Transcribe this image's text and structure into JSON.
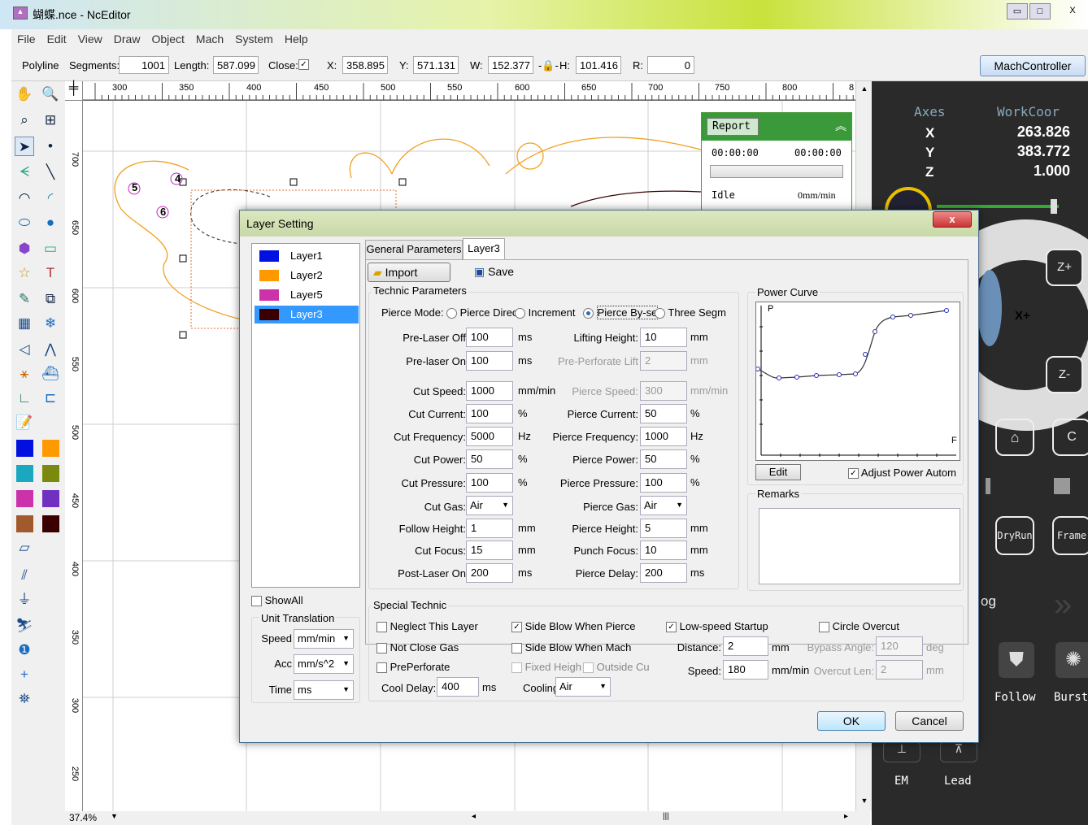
{
  "window": {
    "title": "蝴蝶.nce - NcEditor",
    "min": "▭",
    "max": "□",
    "close": "X"
  },
  "menu": [
    "File",
    "Edit",
    "View",
    "Draw",
    "Object",
    "Mach",
    "System",
    "Help"
  ],
  "props": {
    "type": "Polyline",
    "segments_label": "Segments:",
    "segments": "1001",
    "length_label": "Length:",
    "length": "587.099",
    "close_label": "Close:",
    "close_checked": "✓",
    "x_label": "X:",
    "x": "358.895",
    "y_label": "Y:",
    "y": "571.131",
    "w_label": "W:",
    "w": "152.377",
    "h_label": "H:",
    "h": "101.416",
    "r_label": "R:",
    "r": "0"
  },
  "mach_button": "MachController",
  "ruler_h": [
    "300",
    "350",
    "400",
    "450",
    "500",
    "550",
    "600",
    "650",
    "700",
    "750",
    "800",
    "8"
  ],
  "ruler_v": [
    "700",
    "650",
    "600",
    "550",
    "500",
    "450",
    "400",
    "350",
    "300",
    "250"
  ],
  "canvas_labels": [
    "5",
    "4",
    "6"
  ],
  "zoom": "37.4%",
  "right": {
    "axes": "Axes",
    "workcoor": "WorkCoor",
    "x": "X",
    "y": "Y",
    "z": "Z",
    "xv": "263.826",
    "yv": "383.772",
    "zv": "1.000",
    "zplus": "Z+",
    "zminus": "Z-",
    "xplus": "X+",
    "c": "C",
    "dryrun": "DryRun",
    "frame": "Frame",
    "og": "og",
    "follow": "Follow",
    "burst": "Burst",
    "em": "EM",
    "lead": "Lead"
  },
  "report": {
    "title": "Report",
    "t1": "00:00:00",
    "t2": "00:00:00",
    "status": "Idle",
    "speed": "0mm/min"
  },
  "dialog": {
    "title": "Layer Setting",
    "close": "x",
    "layers": [
      {
        "name": "Layer1",
        "color": "#0010e0"
      },
      {
        "name": "Layer2",
        "color": "#ff9900"
      },
      {
        "name": "Layer5",
        "color": "#cc33aa"
      },
      {
        "name": "Layer3",
        "color": "#3a0000"
      }
    ],
    "showall": "ShowAll",
    "unit_translation": "Unit Translation",
    "speed_label": "Speed",
    "speed": "mm/min",
    "acc_label": "Acc",
    "acc": "mm/s^2",
    "time_label": "Time",
    "time": "ms",
    "tab_general": "General Parameters",
    "tab_layer": "Layer3",
    "import": "Import",
    "save": "Save",
    "technic": "Technic Parameters",
    "pierce_mode": "Pierce Mode:",
    "pm1": "Pierce Direc",
    "pm2": "Increment",
    "pm3": "Pierce By-se",
    "pm4": "Three Segm",
    "fields_left": [
      {
        "label": "Pre-Laser Off",
        "value": "100",
        "unit": "ms"
      },
      {
        "label": "Pre-laser On",
        "value": "100",
        "unit": "ms"
      },
      {
        "label": "Cut Speed:",
        "value": "1000",
        "unit": "mm/min"
      },
      {
        "label": "Cut Current:",
        "value": "100",
        "unit": "%"
      },
      {
        "label": "Cut Frequency:",
        "value": "5000",
        "unit": "Hz"
      },
      {
        "label": "Cut Power:",
        "value": "50",
        "unit": "%"
      },
      {
        "label": "Cut Pressure:",
        "value": "100",
        "unit": "%"
      },
      {
        "label": "Cut Gas:",
        "value": "Air",
        "unit": ""
      },
      {
        "label": "Follow Height:",
        "value": "1",
        "unit": "mm"
      },
      {
        "label": "Cut Focus:",
        "value": "15",
        "unit": "mm"
      },
      {
        "label": "Post-Laser On",
        "value": "200",
        "unit": "ms"
      }
    ],
    "fields_right": [
      {
        "label": "Lifting Height:",
        "value": "10",
        "unit": "mm"
      },
      {
        "label": "Pre-Perforate Lift",
        "value": "2",
        "unit": "mm"
      },
      {
        "label": "Pierce Speed:",
        "value": "300",
        "unit": "mm/min"
      },
      {
        "label": "Pierce Current:",
        "value": "50",
        "unit": "%"
      },
      {
        "label": "Pierce Frequency:",
        "value": "1000",
        "unit": "Hz"
      },
      {
        "label": "Pierce Power:",
        "value": "50",
        "unit": "%"
      },
      {
        "label": "Pierce Pressure:",
        "value": "100",
        "unit": "%"
      },
      {
        "label": "Pierce Gas:",
        "value": "Air",
        "unit": ""
      },
      {
        "label": "Pierce Height:",
        "value": "5",
        "unit": "mm"
      },
      {
        "label": "Punch Focus:",
        "value": "10",
        "unit": "mm"
      },
      {
        "label": "Pierce Delay:",
        "value": "200",
        "unit": "ms"
      }
    ],
    "power_curve": "Power Curve",
    "p": "P",
    "f": "F",
    "edit": "Edit",
    "adjust": "Adjust Power Autom",
    "remarks": "Remarks",
    "special": "Special Technic",
    "neglect": "Neglect This Layer",
    "notclose": "Not Close Gas",
    "preperf": "PrePerforate",
    "cooldelay_label": "Cool Delay:",
    "cooldelay": "400",
    "cooldelay_unit": "ms",
    "sideblow_pierce": "Side Blow When Pierce",
    "sideblow_mach": "Side Blow When Mach",
    "fixed_height": "Fixed Heigh",
    "outside": "Outside Cu",
    "cooling_label": "Cooling",
    "cooling": "Air",
    "lowspeed": "Low-speed Startup",
    "distance_label": "Distance:",
    "distance": "2",
    "distance_unit": "mm",
    "speed2_label": "Speed:",
    "speed2": "180",
    "speed2_unit": "mm/min",
    "circle": "Circle Overcut",
    "bypass_label": "Bypass Angle:",
    "bypass": "120",
    "bypass_unit": "deg",
    "overcut_label": "Overcut Len:",
    "overcut": "2",
    "overcut_unit": "mm",
    "ok": "OK",
    "cancel": "Cancel"
  }
}
